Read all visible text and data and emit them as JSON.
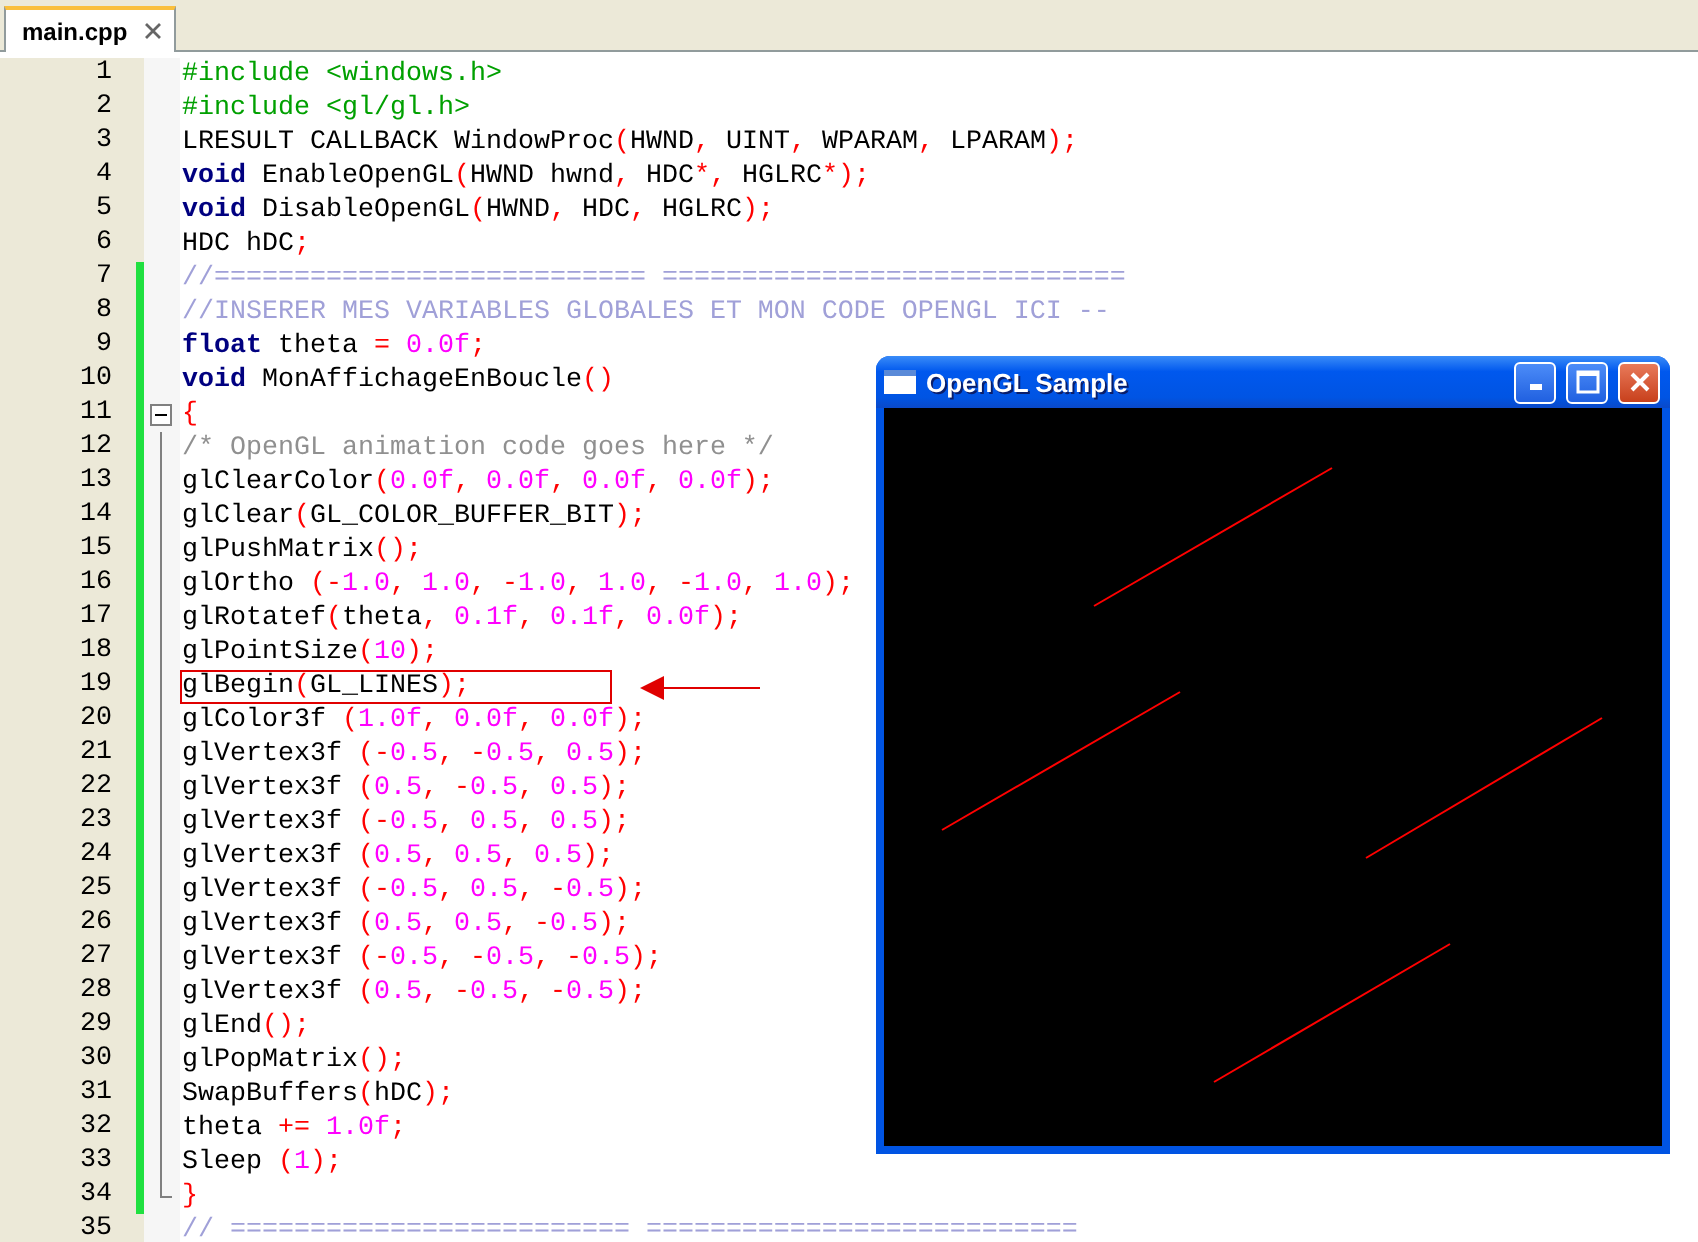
{
  "tabs": [
    {
      "label": "main.cpp",
      "selected": true
    }
  ],
  "editor": {
    "lines": [
      {
        "number": "1",
        "changed": false,
        "boxed": false,
        "tokens": [
          {
            "text": "#include <windows.h>",
            "kind": "preproc"
          }
        ]
      },
      {
        "number": "2",
        "changed": false,
        "boxed": false,
        "tokens": [
          {
            "text": "#include <gl/gl.h>",
            "kind": "preproc"
          }
        ]
      },
      {
        "number": "3",
        "changed": false,
        "boxed": false,
        "tokens": [
          {
            "text": "LRESULT CALLBACK WindowProc",
            "kind": "plain"
          },
          {
            "text": "(",
            "kind": "op"
          },
          {
            "text": "HWND",
            "kind": "plain"
          },
          {
            "text": ",",
            "kind": "op"
          },
          {
            "text": " UINT",
            "kind": "plain"
          },
          {
            "text": ",",
            "kind": "op"
          },
          {
            "text": " WPARAM",
            "kind": "plain"
          },
          {
            "text": ",",
            "kind": "op"
          },
          {
            "text": " LPARAM",
            "kind": "plain"
          },
          {
            "text": ");",
            "kind": "op"
          }
        ]
      },
      {
        "number": "4",
        "changed": false,
        "boxed": false,
        "tokens": [
          {
            "text": "void",
            "kind": "keyword"
          },
          {
            "text": " EnableOpenGL",
            "kind": "plain"
          },
          {
            "text": "(",
            "kind": "op"
          },
          {
            "text": "HWND hwnd",
            "kind": "plain"
          },
          {
            "text": ",",
            "kind": "op"
          },
          {
            "text": " HDC",
            "kind": "plain"
          },
          {
            "text": "*,",
            "kind": "op"
          },
          {
            "text": " HGLRC",
            "kind": "plain"
          },
          {
            "text": "*);",
            "kind": "op"
          }
        ]
      },
      {
        "number": "5",
        "changed": false,
        "boxed": false,
        "tokens": [
          {
            "text": "void",
            "kind": "keyword"
          },
          {
            "text": " DisableOpenGL",
            "kind": "plain"
          },
          {
            "text": "(",
            "kind": "op"
          },
          {
            "text": "HWND",
            "kind": "plain"
          },
          {
            "text": ",",
            "kind": "op"
          },
          {
            "text": " HDC",
            "kind": "plain"
          },
          {
            "text": ",",
            "kind": "op"
          },
          {
            "text": " HGLRC",
            "kind": "plain"
          },
          {
            "text": ");",
            "kind": "op"
          }
        ]
      },
      {
        "number": "6",
        "changed": false,
        "boxed": false,
        "tokens": [
          {
            "text": "HDC hDC",
            "kind": "plain"
          },
          {
            "text": ";",
            "kind": "op"
          }
        ]
      },
      {
        "number": "7",
        "changed": true,
        "boxed": false,
        "tokens": [
          {
            "text": "//=========================== =============================",
            "kind": "comment_line"
          }
        ]
      },
      {
        "number": "8",
        "changed": true,
        "boxed": false,
        "tokens": [
          {
            "text": "//INSERER MES VARIABLES GLOBALES ET MON CODE OPENGL ICI --",
            "kind": "comment_line"
          }
        ]
      },
      {
        "number": "9",
        "changed": true,
        "boxed": false,
        "tokens": [
          {
            "text": "float",
            "kind": "keyword"
          },
          {
            "text": " theta ",
            "kind": "plain"
          },
          {
            "text": "=",
            "kind": "op"
          },
          {
            "text": " 0.0f",
            "kind": "number"
          },
          {
            "text": ";",
            "kind": "op"
          }
        ]
      },
      {
        "number": "10",
        "changed": true,
        "boxed": false,
        "tokens": [
          {
            "text": "void",
            "kind": "keyword"
          },
          {
            "text": " MonAffichageEnBoucle",
            "kind": "plain"
          },
          {
            "text": "()",
            "kind": "op"
          }
        ]
      },
      {
        "number": "11",
        "changed": true,
        "boxed": false,
        "kind": "fold_start",
        "tokens": [
          {
            "text": "{",
            "kind": "op"
          }
        ]
      },
      {
        "number": "12",
        "changed": true,
        "boxed": false,
        "kind": "fold_body",
        "tokens": [
          {
            "text": "/* OpenGL animation code goes here */",
            "kind": "comment_block"
          }
        ]
      },
      {
        "number": "13",
        "changed": true,
        "boxed": false,
        "kind": "fold_body",
        "tokens": [
          {
            "text": "glClearColor",
            "kind": "plain"
          },
          {
            "text": "(",
            "kind": "op"
          },
          {
            "text": "0.0f",
            "kind": "number"
          },
          {
            "text": ",",
            "kind": "op"
          },
          {
            "text": " 0.0f",
            "kind": "number"
          },
          {
            "text": ",",
            "kind": "op"
          },
          {
            "text": " 0.0f",
            "kind": "number"
          },
          {
            "text": ",",
            "kind": "op"
          },
          {
            "text": " 0.0f",
            "kind": "number"
          },
          {
            "text": ");",
            "kind": "op"
          }
        ]
      },
      {
        "number": "14",
        "changed": true,
        "boxed": false,
        "kind": "fold_body",
        "tokens": [
          {
            "text": "glClear",
            "kind": "plain"
          },
          {
            "text": "(",
            "kind": "op"
          },
          {
            "text": "GL_COLOR_BUFFER_BIT",
            "kind": "plain"
          },
          {
            "text": ");",
            "kind": "op"
          }
        ]
      },
      {
        "number": "15",
        "changed": true,
        "boxed": false,
        "kind": "fold_body",
        "tokens": [
          {
            "text": "glPushMatrix",
            "kind": "plain"
          },
          {
            "text": "();",
            "kind": "op"
          }
        ]
      },
      {
        "number": "16",
        "changed": true,
        "boxed": false,
        "kind": "fold_body",
        "tokens": [
          {
            "text": "glOrtho ",
            "kind": "plain"
          },
          {
            "text": "(-",
            "kind": "op"
          },
          {
            "text": "1.0",
            "kind": "number"
          },
          {
            "text": ",",
            "kind": "op"
          },
          {
            "text": " 1.0",
            "kind": "number"
          },
          {
            "text": ", -",
            "kind": "op"
          },
          {
            "text": "1.0",
            "kind": "number"
          },
          {
            "text": ",",
            "kind": "op"
          },
          {
            "text": " 1.0",
            "kind": "number"
          },
          {
            "text": ", -",
            "kind": "op"
          },
          {
            "text": "1.0",
            "kind": "number"
          },
          {
            "text": ",",
            "kind": "op"
          },
          {
            "text": " 1.0",
            "kind": "number"
          },
          {
            "text": ");",
            "kind": "op"
          }
        ]
      },
      {
        "number": "17",
        "changed": true,
        "boxed": false,
        "kind": "fold_body",
        "tokens": [
          {
            "text": "glRotatef",
            "kind": "plain"
          },
          {
            "text": "(",
            "kind": "op"
          },
          {
            "text": "theta",
            "kind": "plain"
          },
          {
            "text": ",",
            "kind": "op"
          },
          {
            "text": " 0.1f",
            "kind": "number"
          },
          {
            "text": ",",
            "kind": "op"
          },
          {
            "text": " 0.1f",
            "kind": "number"
          },
          {
            "text": ",",
            "kind": "op"
          },
          {
            "text": " 0.0f",
            "kind": "number"
          },
          {
            "text": ");",
            "kind": "op"
          }
        ]
      },
      {
        "number": "18",
        "changed": true,
        "boxed": false,
        "kind": "fold_body",
        "tokens": [
          {
            "text": "glPointSize",
            "kind": "plain"
          },
          {
            "text": "(",
            "kind": "op"
          },
          {
            "text": "10",
            "kind": "number"
          },
          {
            "text": ");",
            "kind": "op"
          }
        ]
      },
      {
        "number": "19",
        "changed": true,
        "boxed": true,
        "kind": "fold_body",
        "tokens": [
          {
            "text": "glBegin",
            "kind": "plain"
          },
          {
            "text": "(",
            "kind": "op"
          },
          {
            "text": "GL_LINES",
            "kind": "plain"
          },
          {
            "text": ");",
            "kind": "op"
          }
        ]
      },
      {
        "number": "20",
        "changed": true,
        "boxed": false,
        "kind": "fold_body",
        "tokens": [
          {
            "text": "glColor3f ",
            "kind": "plain"
          },
          {
            "text": "(",
            "kind": "op"
          },
          {
            "text": "1.0f",
            "kind": "number"
          },
          {
            "text": ",",
            "kind": "op"
          },
          {
            "text": " 0.0f",
            "kind": "number"
          },
          {
            "text": ",",
            "kind": "op"
          },
          {
            "text": " 0.0f",
            "kind": "number"
          },
          {
            "text": ");",
            "kind": "op"
          }
        ]
      },
      {
        "number": "21",
        "changed": true,
        "boxed": false,
        "kind": "fold_body",
        "tokens": [
          {
            "text": "glVertex3f ",
            "kind": "plain"
          },
          {
            "text": "(-",
            "kind": "op"
          },
          {
            "text": "0.5",
            "kind": "number"
          },
          {
            "text": ", -",
            "kind": "op"
          },
          {
            "text": "0.5",
            "kind": "number"
          },
          {
            "text": ",",
            "kind": "op"
          },
          {
            "text": " 0.5",
            "kind": "number"
          },
          {
            "text": ");",
            "kind": "op"
          }
        ]
      },
      {
        "number": "22",
        "changed": true,
        "boxed": false,
        "kind": "fold_body",
        "tokens": [
          {
            "text": "glVertex3f ",
            "kind": "plain"
          },
          {
            "text": "(",
            "kind": "op"
          },
          {
            "text": "0.5",
            "kind": "number"
          },
          {
            "text": ", -",
            "kind": "op"
          },
          {
            "text": "0.5",
            "kind": "number"
          },
          {
            "text": ",",
            "kind": "op"
          },
          {
            "text": " 0.5",
            "kind": "number"
          },
          {
            "text": ");",
            "kind": "op"
          }
        ]
      },
      {
        "number": "23",
        "changed": true,
        "boxed": false,
        "kind": "fold_body",
        "tokens": [
          {
            "text": "glVertex3f ",
            "kind": "plain"
          },
          {
            "text": "(-",
            "kind": "op"
          },
          {
            "text": "0.5",
            "kind": "number"
          },
          {
            "text": ",",
            "kind": "op"
          },
          {
            "text": " 0.5",
            "kind": "number"
          },
          {
            "text": ",",
            "kind": "op"
          },
          {
            "text": " 0.5",
            "kind": "number"
          },
          {
            "text": ");",
            "kind": "op"
          }
        ]
      },
      {
        "number": "24",
        "changed": true,
        "boxed": false,
        "kind": "fold_body",
        "tokens": [
          {
            "text": "glVertex3f ",
            "kind": "plain"
          },
          {
            "text": "(",
            "kind": "op"
          },
          {
            "text": "0.5",
            "kind": "number"
          },
          {
            "text": ",",
            "kind": "op"
          },
          {
            "text": " 0.5",
            "kind": "number"
          },
          {
            "text": ",",
            "kind": "op"
          },
          {
            "text": " 0.5",
            "kind": "number"
          },
          {
            "text": ");",
            "kind": "op"
          }
        ]
      },
      {
        "number": "25",
        "changed": true,
        "boxed": false,
        "kind": "fold_body",
        "tokens": [
          {
            "text": "glVertex3f ",
            "kind": "plain"
          },
          {
            "text": "(-",
            "kind": "op"
          },
          {
            "text": "0.5",
            "kind": "number"
          },
          {
            "text": ",",
            "kind": "op"
          },
          {
            "text": " 0.5",
            "kind": "number"
          },
          {
            "text": ", -",
            "kind": "op"
          },
          {
            "text": "0.5",
            "kind": "number"
          },
          {
            "text": ");",
            "kind": "op"
          }
        ]
      },
      {
        "number": "26",
        "changed": true,
        "boxed": false,
        "kind": "fold_body",
        "tokens": [
          {
            "text": "glVertex3f ",
            "kind": "plain"
          },
          {
            "text": "(",
            "kind": "op"
          },
          {
            "text": "0.5",
            "kind": "number"
          },
          {
            "text": ",",
            "kind": "op"
          },
          {
            "text": " 0.5",
            "kind": "number"
          },
          {
            "text": ", -",
            "kind": "op"
          },
          {
            "text": "0.5",
            "kind": "number"
          },
          {
            "text": ");",
            "kind": "op"
          }
        ]
      },
      {
        "number": "27",
        "changed": true,
        "boxed": false,
        "kind": "fold_body",
        "tokens": [
          {
            "text": "glVertex3f ",
            "kind": "plain"
          },
          {
            "text": "(-",
            "kind": "op"
          },
          {
            "text": "0.5",
            "kind": "number"
          },
          {
            "text": ", -",
            "kind": "op"
          },
          {
            "text": "0.5",
            "kind": "number"
          },
          {
            "text": ", -",
            "kind": "op"
          },
          {
            "text": "0.5",
            "kind": "number"
          },
          {
            "text": ");",
            "kind": "op"
          }
        ]
      },
      {
        "number": "28",
        "changed": true,
        "boxed": false,
        "kind": "fold_body",
        "tokens": [
          {
            "text": "glVertex3f ",
            "kind": "plain"
          },
          {
            "text": "(",
            "kind": "op"
          },
          {
            "text": "0.5",
            "kind": "number"
          },
          {
            "text": ", -",
            "kind": "op"
          },
          {
            "text": "0.5",
            "kind": "number"
          },
          {
            "text": ", -",
            "kind": "op"
          },
          {
            "text": "0.5",
            "kind": "number"
          },
          {
            "text": ");",
            "kind": "op"
          }
        ]
      },
      {
        "number": "29",
        "changed": true,
        "boxed": false,
        "kind": "fold_body",
        "tokens": [
          {
            "text": "glEnd",
            "kind": "plain"
          },
          {
            "text": "();",
            "kind": "op"
          }
        ]
      },
      {
        "number": "30",
        "changed": true,
        "boxed": false,
        "kind": "fold_body",
        "tokens": [
          {
            "text": "glPopMatrix",
            "kind": "plain"
          },
          {
            "text": "();",
            "kind": "op"
          }
        ]
      },
      {
        "number": "31",
        "changed": true,
        "boxed": false,
        "kind": "fold_body",
        "tokens": [
          {
            "text": "SwapBuffers",
            "kind": "plain"
          },
          {
            "text": "(",
            "kind": "op"
          },
          {
            "text": "hDC",
            "kind": "plain"
          },
          {
            "text": ");",
            "kind": "op"
          }
        ]
      },
      {
        "number": "32",
        "changed": true,
        "boxed": false,
        "kind": "fold_body",
        "tokens": [
          {
            "text": "theta ",
            "kind": "plain"
          },
          {
            "text": "+=",
            "kind": "op"
          },
          {
            "text": " 1.0f",
            "kind": "number"
          },
          {
            "text": ";",
            "kind": "op"
          }
        ]
      },
      {
        "number": "33",
        "changed": true,
        "boxed": false,
        "kind": "fold_body",
        "tokens": [
          {
            "text": "Sleep ",
            "kind": "plain"
          },
          {
            "text": "(",
            "kind": "op"
          },
          {
            "text": "1",
            "kind": "number"
          },
          {
            "text": ");",
            "kind": "op"
          }
        ]
      },
      {
        "number": "34",
        "changed": true,
        "boxed": false,
        "kind": "fold_end",
        "tokens": [
          {
            "text": "}",
            "kind": "op"
          }
        ]
      },
      {
        "number": "35",
        "changed": false,
        "boxed": false,
        "tokens": [
          {
            "text": "// ========================= ===========================",
            "kind": "comment_line"
          }
        ]
      }
    ]
  },
  "gl_window": {
    "title": "OpenGL Sample"
  }
}
